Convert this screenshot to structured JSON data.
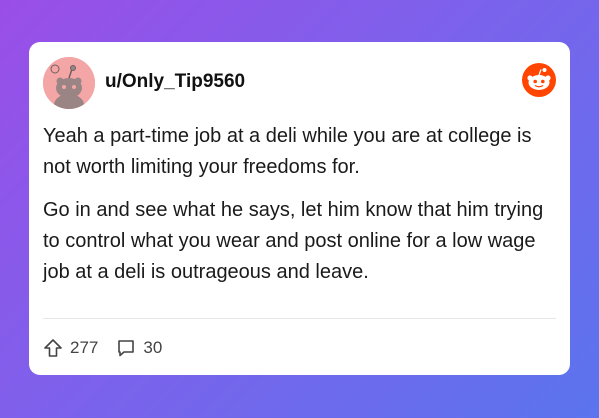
{
  "post": {
    "username": "u/Only_Tip9560",
    "paragraphs": [
      "Yeah a part-time job at a deli while you are at college is not worth limiting your freedoms for.",
      "Go in and see what he says, let him know that him trying to control what you wear and post online for a low wage job at a deli is outrageous and leave."
    ],
    "upvotes": "277",
    "comments": "30"
  },
  "icons": {
    "avatar": "reddit-snoo-avatar",
    "logo": "reddit-logo-icon",
    "upvote": "upvote-arrow-icon",
    "comment": "comment-bubble-icon"
  },
  "colors": {
    "background_start": "#9a4ee8",
    "background_end": "#5b74ee",
    "reddit_orange": "#ff4500",
    "avatar_bg": "#f4a6a6"
  }
}
